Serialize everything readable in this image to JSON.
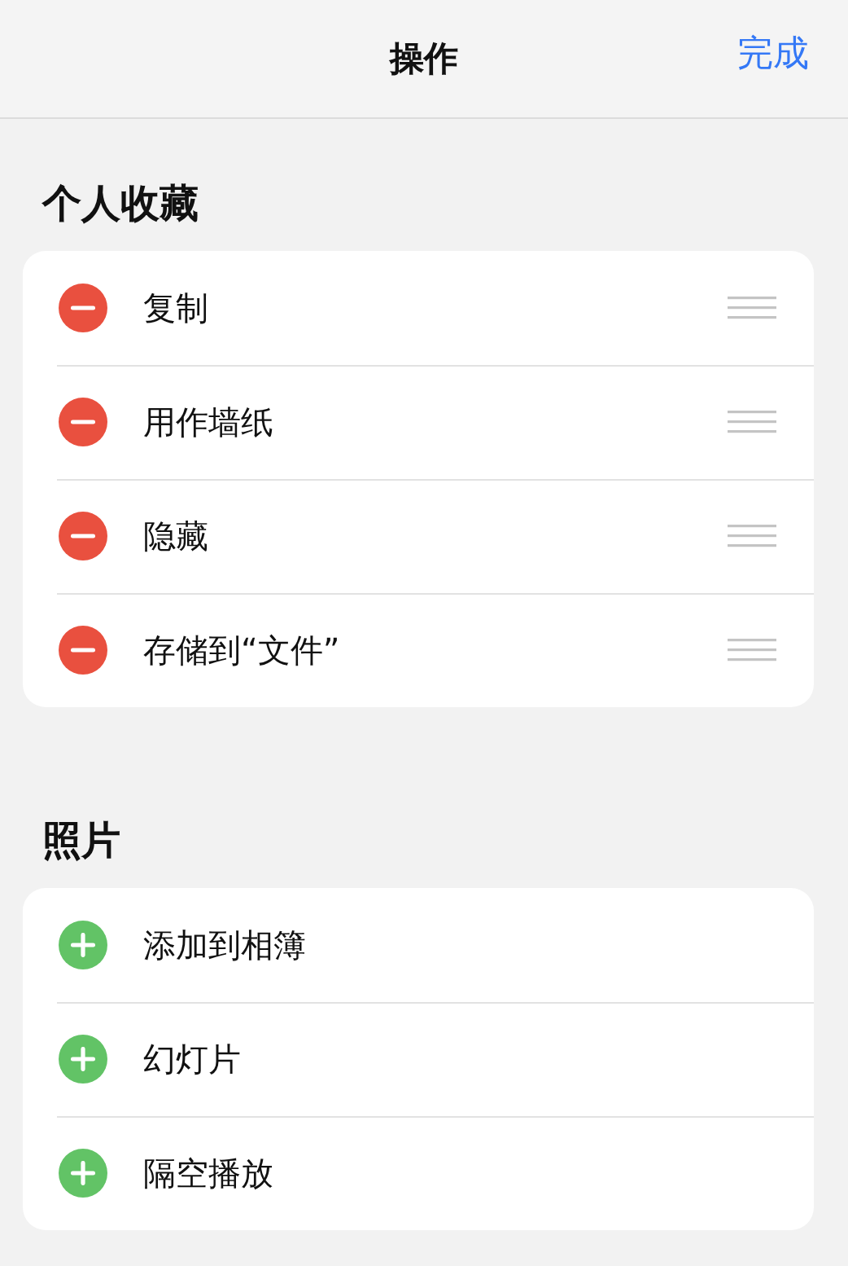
{
  "navigation_bar": {
    "title": "操作",
    "done_button": "完成"
  },
  "sections": [
    {
      "title": "个人收藏",
      "items": [
        {
          "label": "复制",
          "kind": "remove"
        },
        {
          "label": "用作墙纸",
          "kind": "remove"
        },
        {
          "label": "隐藏",
          "kind": "remove"
        },
        {
          "label": "存储到“文件”",
          "kind": "remove"
        }
      ]
    },
    {
      "title": "照片",
      "items": [
        {
          "label": "添加到相簿",
          "kind": "add"
        },
        {
          "label": "幻灯片",
          "kind": "add"
        },
        {
          "label": "隔空播放",
          "kind": "add"
        }
      ]
    }
  ]
}
